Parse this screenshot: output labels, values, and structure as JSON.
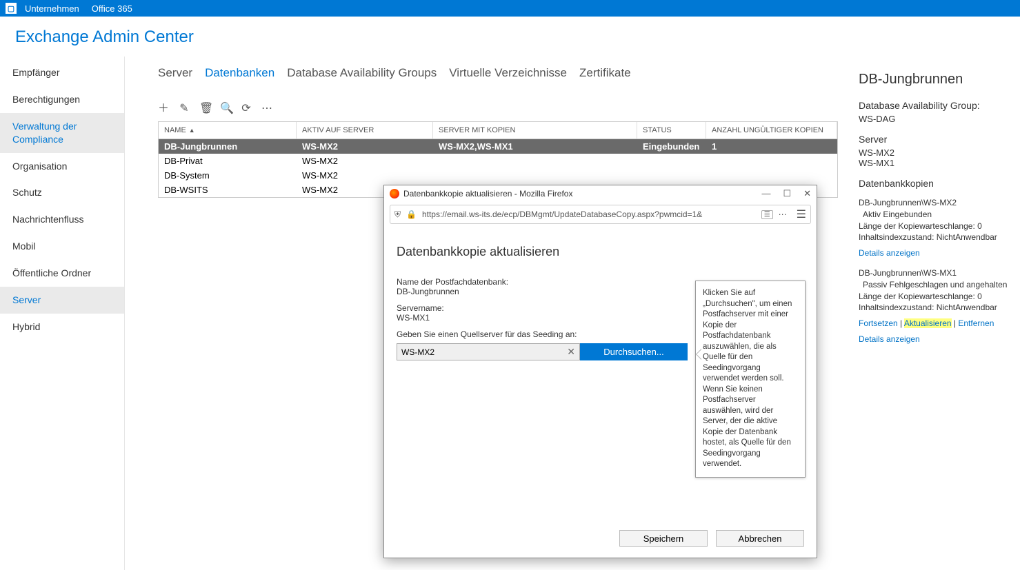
{
  "topbar": {
    "company": "Unternehmen",
    "office": "Office 365"
  },
  "page_title": "Exchange Admin Center",
  "sidebar": [
    {
      "label": "Empfänger",
      "active": false
    },
    {
      "label": "Berechtigungen",
      "active": false
    },
    {
      "label": "Verwaltung der Compliance",
      "active": true
    },
    {
      "label": "Organisation",
      "active": false
    },
    {
      "label": "Schutz",
      "active": false
    },
    {
      "label": "Nachrichtenfluss",
      "active": false
    },
    {
      "label": "Mobil",
      "active": false
    },
    {
      "label": "Öffentliche Ordner",
      "active": false
    },
    {
      "label": "Server",
      "active": true
    },
    {
      "label": "Hybrid",
      "active": false
    }
  ],
  "tabs": [
    {
      "label": "Server",
      "active": false
    },
    {
      "label": "Datenbanken",
      "active": true
    },
    {
      "label": "Database Availability Groups",
      "active": false
    },
    {
      "label": "Virtuelle Verzeichnisse",
      "active": false
    },
    {
      "label": "Zertifikate",
      "active": false
    }
  ],
  "columns": {
    "name": "NAME",
    "active": "AKTIV AUF SERVER",
    "copies": "SERVER MIT KOPIEN",
    "status": "STATUS",
    "invalid": "ANZAHL UNGÜLTIGER KOPIEN"
  },
  "rows": [
    {
      "name": "DB-Jungbrunnen",
      "active": "WS-MX2",
      "copies": "WS-MX2,WS-MX1",
      "status": "Eingebunden",
      "invalid": "1",
      "selected": true
    },
    {
      "name": "DB-Privat",
      "active": "WS-MX2",
      "copies": "",
      "status": "",
      "invalid": ""
    },
    {
      "name": "DB-System",
      "active": "WS-MX2",
      "copies": "",
      "status": "",
      "invalid": ""
    },
    {
      "name": "DB-WSITS",
      "active": "WS-MX2",
      "copies": "",
      "status": "",
      "invalid": ""
    }
  ],
  "details": {
    "title": "DB-Jungbrunnen",
    "dag_label": "Database Availability Group:",
    "dag_value": "WS-DAG",
    "server_label": "Server",
    "servers": [
      "WS-MX2",
      "WS-MX1"
    ],
    "copies_label": "Datenbankkopien",
    "copy1": {
      "name": "DB-Jungbrunnen\\WS-MX2",
      "state": "Aktiv Eingebunden",
      "queue": "Länge der Kopiewarteschlange: 0",
      "index": "Inhaltsindexzustand: NichtAnwendbar",
      "details_link": "Details anzeigen"
    },
    "copy2": {
      "name": "DB-Jungbrunnen\\WS-MX1",
      "state": "Passiv Fehlgeschlagen und angehalten",
      "queue": "Länge der Kopiewarteschlange: 0",
      "index": "Inhaltsindexzustand: NichtAnwendbar",
      "resume": "Fortsetzen",
      "update": "Aktualisieren",
      "remove": "Entfernen",
      "details_link": "Details anzeigen"
    }
  },
  "popup": {
    "window_title": "Datenbankkopie aktualisieren - Mozilla Firefox",
    "url": "https://email.ws-its.de/ecp/DBMgmt/UpdateDatabaseCopy.aspx?pwmcid=1&",
    "heading": "Datenbankkopie aktualisieren",
    "db_label": "Name der Postfachdatenbank:",
    "db_value": "DB-Jungbrunnen",
    "server_label": "Servername:",
    "server_value": "WS-MX1",
    "source_label": "Geben Sie einen Quellserver für das Seeding an:",
    "source_value": "WS-MX2",
    "browse": "Durchsuchen...",
    "tooltip": "Klicken Sie auf „Durchsuchen\", um einen Postfachserver mit einer Kopie der Postfachdatenbank auszuwählen, die als Quelle für den Seedingvorgang verwendet werden soll. Wenn Sie keinen Postfachserver auswählen, wird der Server, der die aktive Kopie der Datenbank hostet, als Quelle für den Seedingvorgang verwendet.",
    "save": "Speichern",
    "cancel": "Abbrechen"
  }
}
